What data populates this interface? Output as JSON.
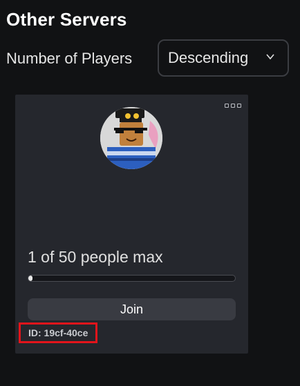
{
  "section": {
    "title": "Other Servers"
  },
  "sort": {
    "label": "Number of Players",
    "selected": "Descending"
  },
  "server_card": {
    "player_count_text": "1 of 50 people max",
    "players": 1,
    "max_players": 50,
    "join_label": "Join",
    "server_id": "ID: 19cf-40ce",
    "highlight_color": "#e3141b"
  },
  "icons": [
    "chevron-down-icon",
    "more-options-icon",
    "avatar"
  ]
}
